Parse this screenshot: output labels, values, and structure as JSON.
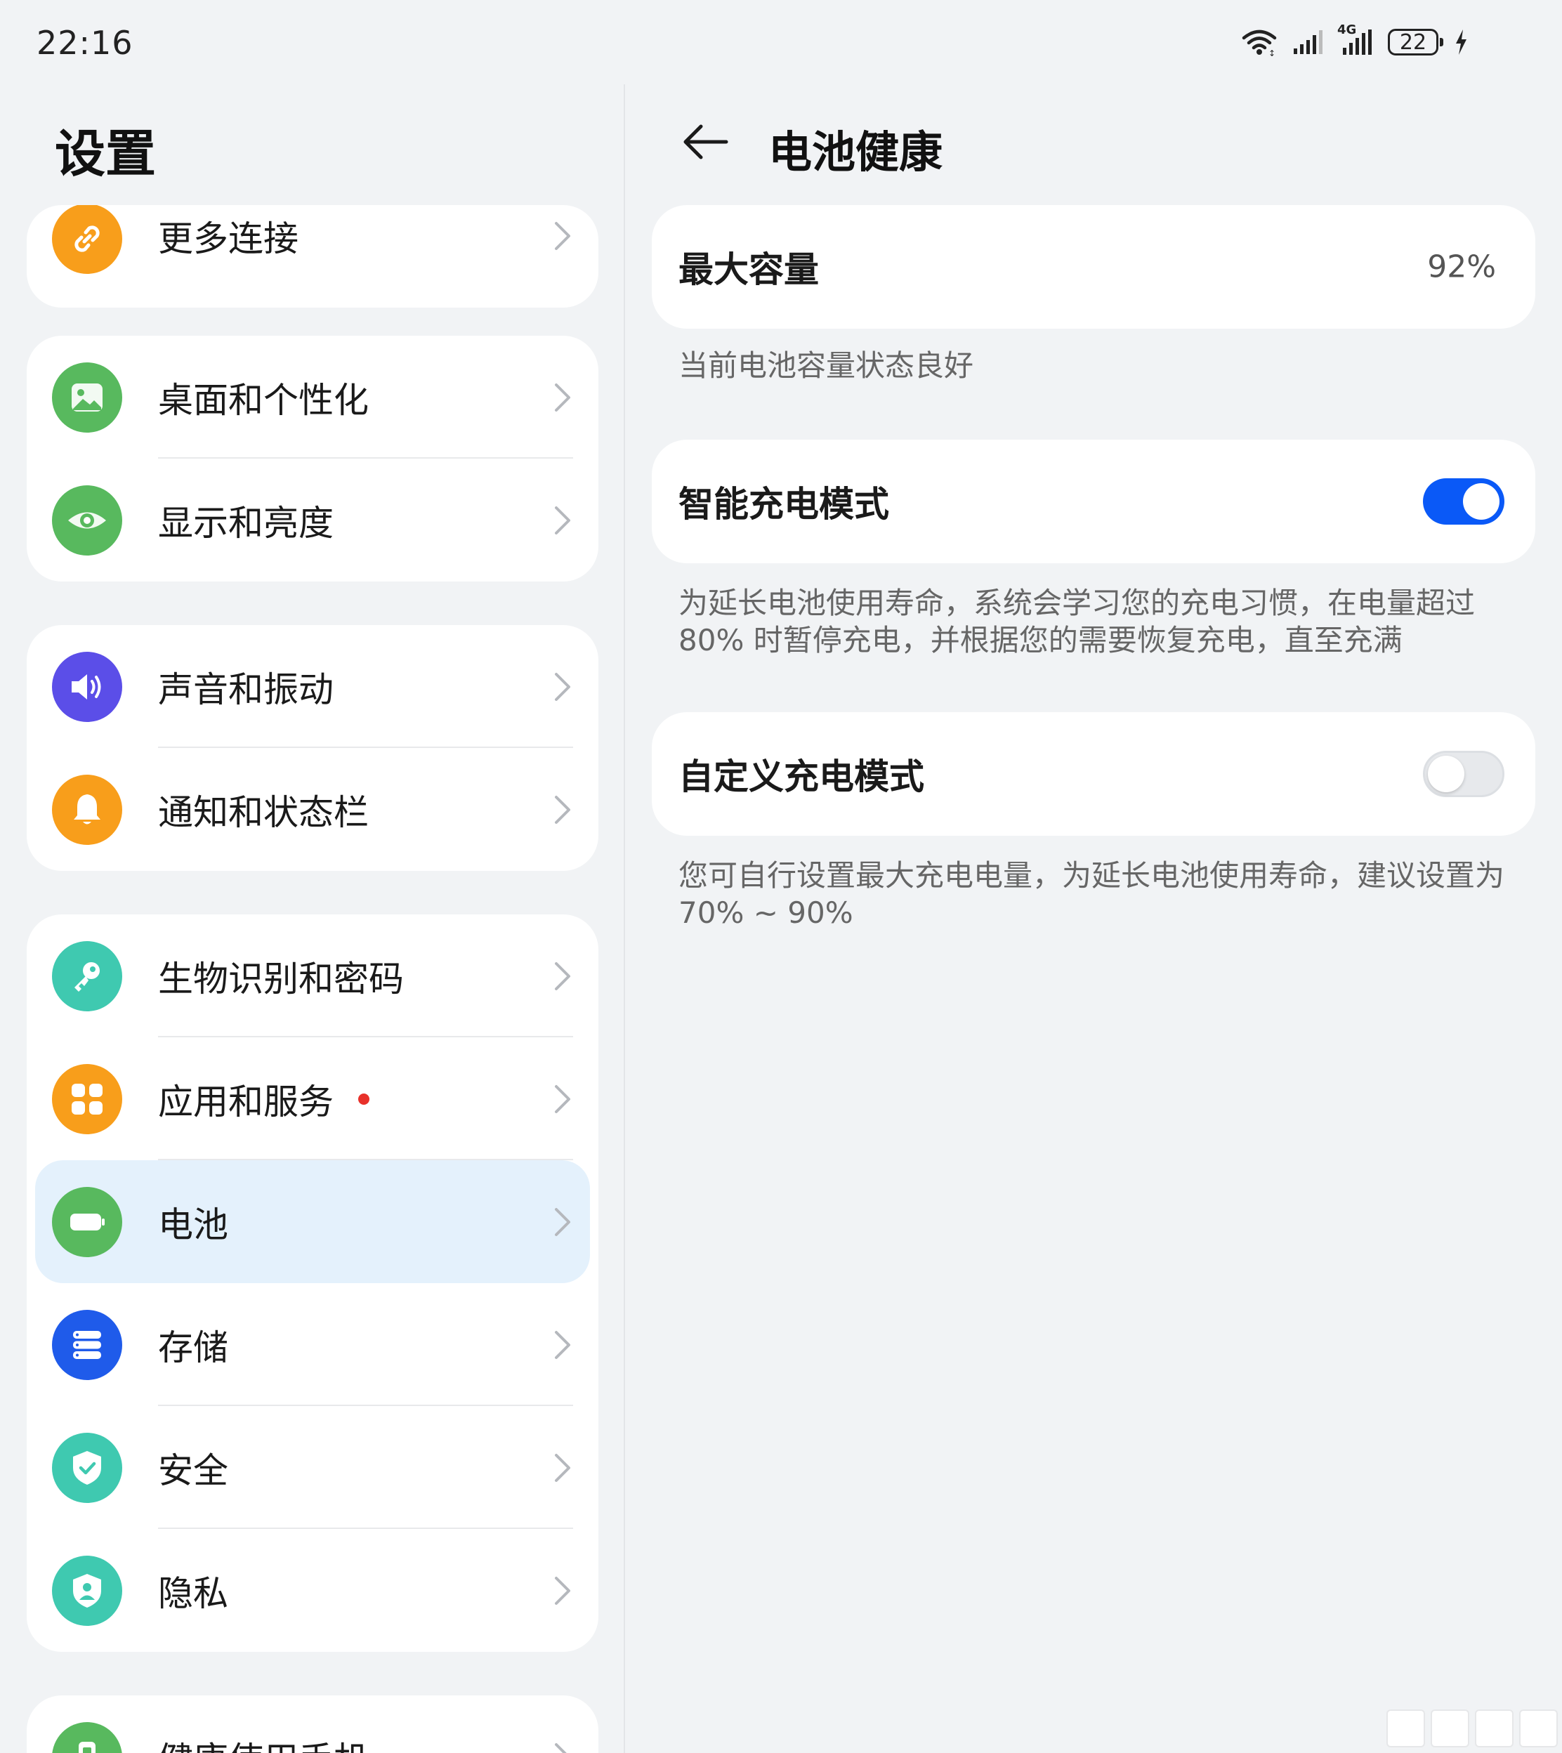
{
  "status_bar": {
    "time": "22:16",
    "network_label": "4G",
    "battery_level": "22",
    "icons": [
      "wifi-icon",
      "signal-icon",
      "4g-signal-icon",
      "battery-icon",
      "charging-icon"
    ]
  },
  "sidebar": {
    "title": "设置",
    "groups": [
      {
        "items": [
          {
            "label": "更多连接",
            "icon": "link-icon",
            "color": "#f89e1b"
          }
        ]
      },
      {
        "items": [
          {
            "label": "桌面和个性化",
            "icon": "picture-icon",
            "color": "#58b95e"
          },
          {
            "label": "显示和亮度",
            "icon": "eye-icon",
            "color": "#58b95e"
          }
        ]
      },
      {
        "items": [
          {
            "label": "声音和振动",
            "icon": "speaker-icon",
            "color": "#5b4ee8"
          },
          {
            "label": "通知和状态栏",
            "icon": "bell-icon",
            "color": "#f89e1b"
          }
        ]
      },
      {
        "items": [
          {
            "label": "生物识别和密码",
            "icon": "key-icon",
            "color": "#3fc9b0"
          },
          {
            "label": "应用和服务",
            "icon": "apps-icon",
            "color": "#f89e1b",
            "badge": "red-dot"
          },
          {
            "label": "电池",
            "icon": "battery-icon",
            "color": "#58b95e",
            "selected": true
          },
          {
            "label": "存储",
            "icon": "storage-icon",
            "color": "#1f5bea"
          },
          {
            "label": "安全",
            "icon": "shield-check-icon",
            "color": "#3fc9b0"
          },
          {
            "label": "隐私",
            "icon": "privacy-shield-icon",
            "color": "#3fc9b0"
          }
        ]
      },
      {
        "items": [
          {
            "label": "健康使用手机",
            "icon": "phone-health-icon",
            "color": "#58b95e"
          }
        ]
      }
    ]
  },
  "detail": {
    "title": "电池健康",
    "back_icon": "arrow-left-icon",
    "max_capacity": {
      "label": "最大容量",
      "value": "92%",
      "description": "当前电池容量状态良好"
    },
    "smart_charging": {
      "label": "智能充电模式",
      "enabled": true,
      "description": "为延长电池使用寿命，系统会学习您的充电习惯，在电量超过 80% 时暂停充电，并根据您的需要恢复充电，直至充满"
    },
    "custom_charging": {
      "label": "自定义充电模式",
      "enabled": false,
      "description": "您可自行设置最大充电电量，为延长电池使用寿命，建议设置为 70% ~ 90%"
    }
  },
  "colors": {
    "accent": "#0a59f7",
    "selected_bg": "#e4f1fc",
    "page_bg": "#f1f3f5"
  }
}
